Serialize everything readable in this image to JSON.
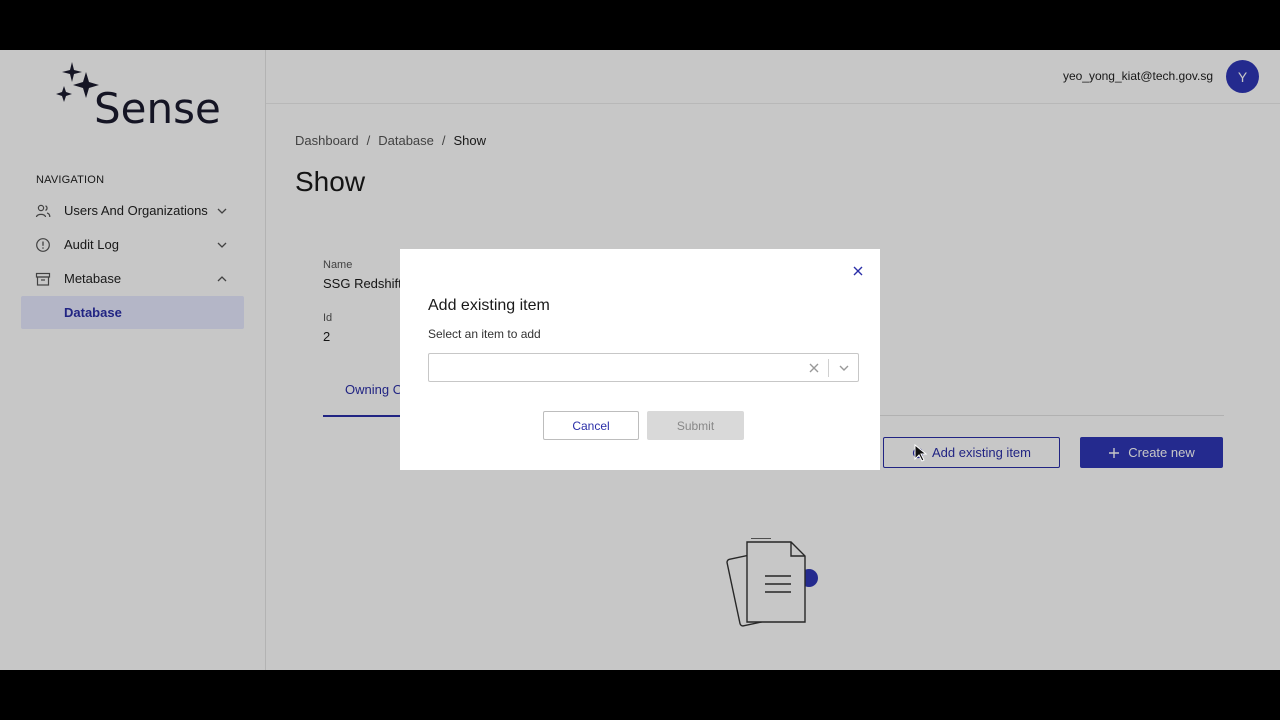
{
  "brand": {
    "name": "Sense"
  },
  "navigation": {
    "heading": "NAVIGATION",
    "items": [
      {
        "label": "Users And Organizations",
        "icon": "users-icon",
        "expanded": false
      },
      {
        "label": "Audit Log",
        "icon": "alert-circle-icon",
        "expanded": false
      },
      {
        "label": "Metabase",
        "icon": "archive-icon",
        "expanded": true
      }
    ],
    "sub_items": [
      {
        "label": "Database",
        "active": true
      }
    ]
  },
  "header": {
    "user_email": "yeo_yong_kiat@tech.gov.sg",
    "avatar_initial": "Y"
  },
  "breadcrumb": {
    "items": [
      "Dashboard",
      "Database",
      "Show"
    ],
    "separator": "/"
  },
  "page": {
    "title": "Show",
    "fields": [
      {
        "label": "Name",
        "value": "SSG Redshift"
      },
      {
        "label": "Id",
        "value": "2"
      }
    ],
    "tab_label": "Owning Or",
    "actions": {
      "add_existing": "Add existing item",
      "create_new": "Create new"
    }
  },
  "modal": {
    "title": "Add existing item",
    "subtitle": "Select an item to add",
    "select_value": "",
    "cancel_label": "Cancel",
    "submit_label": "Submit",
    "submit_disabled": true
  },
  "colors": {
    "accent": "#2f37b7",
    "active_nav_bg": "#e7eaff",
    "overlay": "rgba(0,0,0,0.22)"
  }
}
